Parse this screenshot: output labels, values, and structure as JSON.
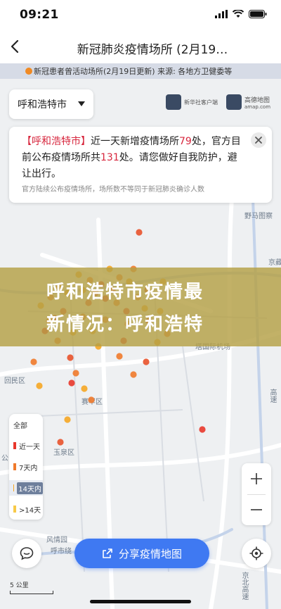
{
  "status_bar": {
    "time": "09:21"
  },
  "nav": {
    "title": "新冠肺炎疫情场所 (2月19…"
  },
  "banner": {
    "text": "新冠患者曾活动场所(2月19日更新) 来源: 各地方卫健委等"
  },
  "city_select": {
    "value": "呼和浩特市"
  },
  "logos": {
    "xinhua": "新华社客户端",
    "amap_name": "高德地图",
    "amap_url": "amap.com"
  },
  "info_card": {
    "city": "【呼和浩特市】",
    "part1": "近一天新增疫情场所",
    "new_count": "79",
    "part2": "处，官方目前公布疫情场所共",
    "total_count": "131",
    "part3": "处。请您做好自我防护，避让出行。",
    "note": "官方陆续公布疫情场所，场所数不等同于新冠肺炎确诊人数"
  },
  "overlay": {
    "line1": "呼和浩特市疫情最",
    "line2": "新情况：呼和浩特"
  },
  "map_labels": {
    "yematuro": "野马图察",
    "jingzang": "京藏",
    "tower": "塔国际机场",
    "huimin": "回民区",
    "saihan": "赛罕区",
    "yuquan": "玉泉区",
    "gong": "公",
    "fengqing": "风情园",
    "gaosu": "高速",
    "ring": "呼市绕",
    "jingbei": "京北高速"
  },
  "legend": {
    "items": [
      {
        "label": "全部"
      },
      {
        "label": "近一天",
        "color": "#e8372b"
      },
      {
        "label": "7天内",
        "color": "#f07a2b"
      },
      {
        "label": "14天内",
        "color": "#f5a623"
      },
      {
        "label": ">14天",
        "color": "#f7c948"
      }
    ],
    "selected": "14天内"
  },
  "share_button": {
    "label": "分享疫情地图"
  },
  "scale": {
    "label": "5 公里"
  },
  "colors": {
    "accent": "#3f79f2",
    "dot_new": "#e8372b",
    "dot_week": "#f07a2b"
  }
}
